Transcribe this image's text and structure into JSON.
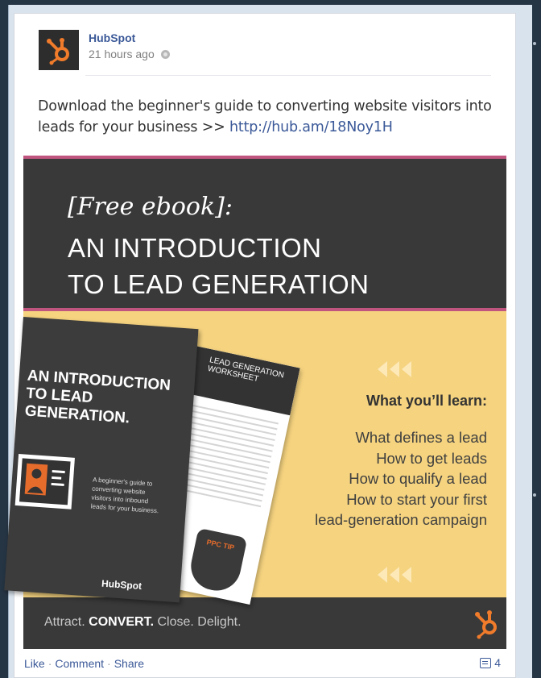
{
  "post": {
    "page_name": "HubSpot",
    "timestamp": "21 hours ago",
    "message_text": "Download the beginner's guide to converting website visitors into leads for your business >> ",
    "message_link": "http://hub.am/18Noy1H",
    "avatar_icon": "hubspot-sprocket-icon",
    "privacy_icon": "globe-icon"
  },
  "banner": {
    "tag": "[Free ebook]:",
    "title_line1": "AN INTRODUCTION",
    "title_line2": "TO LEAD GENERATION",
    "learn_heading": "What you’ll learn:",
    "learn_items": [
      "What defines a lead",
      "How to get leads",
      "How to qualify a lead",
      "How to start your first",
      "lead-generation campaign"
    ],
    "book_title": "AN INTRODUCTION TO LEAD GENERATION.",
    "book_desc": "A beginner's guide to converting website visitors into inbound leads for your business.",
    "book_publisher": "HubSpot",
    "sheet_title": "LEAD GENERATION WORKSHEET",
    "tagline_1": "Attract.",
    "tagline_2": "CONVERT.",
    "tagline_3": "Close. Delight.",
    "colors": {
      "dark": "#393939",
      "yellow": "#f5d37f",
      "pink": "#c0557f",
      "orange": "#e66c2c"
    }
  },
  "actions": {
    "like": "Like",
    "comment": "Comment",
    "share": "Share",
    "comment_count": "4",
    "comment_icon": "comment-count-icon"
  }
}
